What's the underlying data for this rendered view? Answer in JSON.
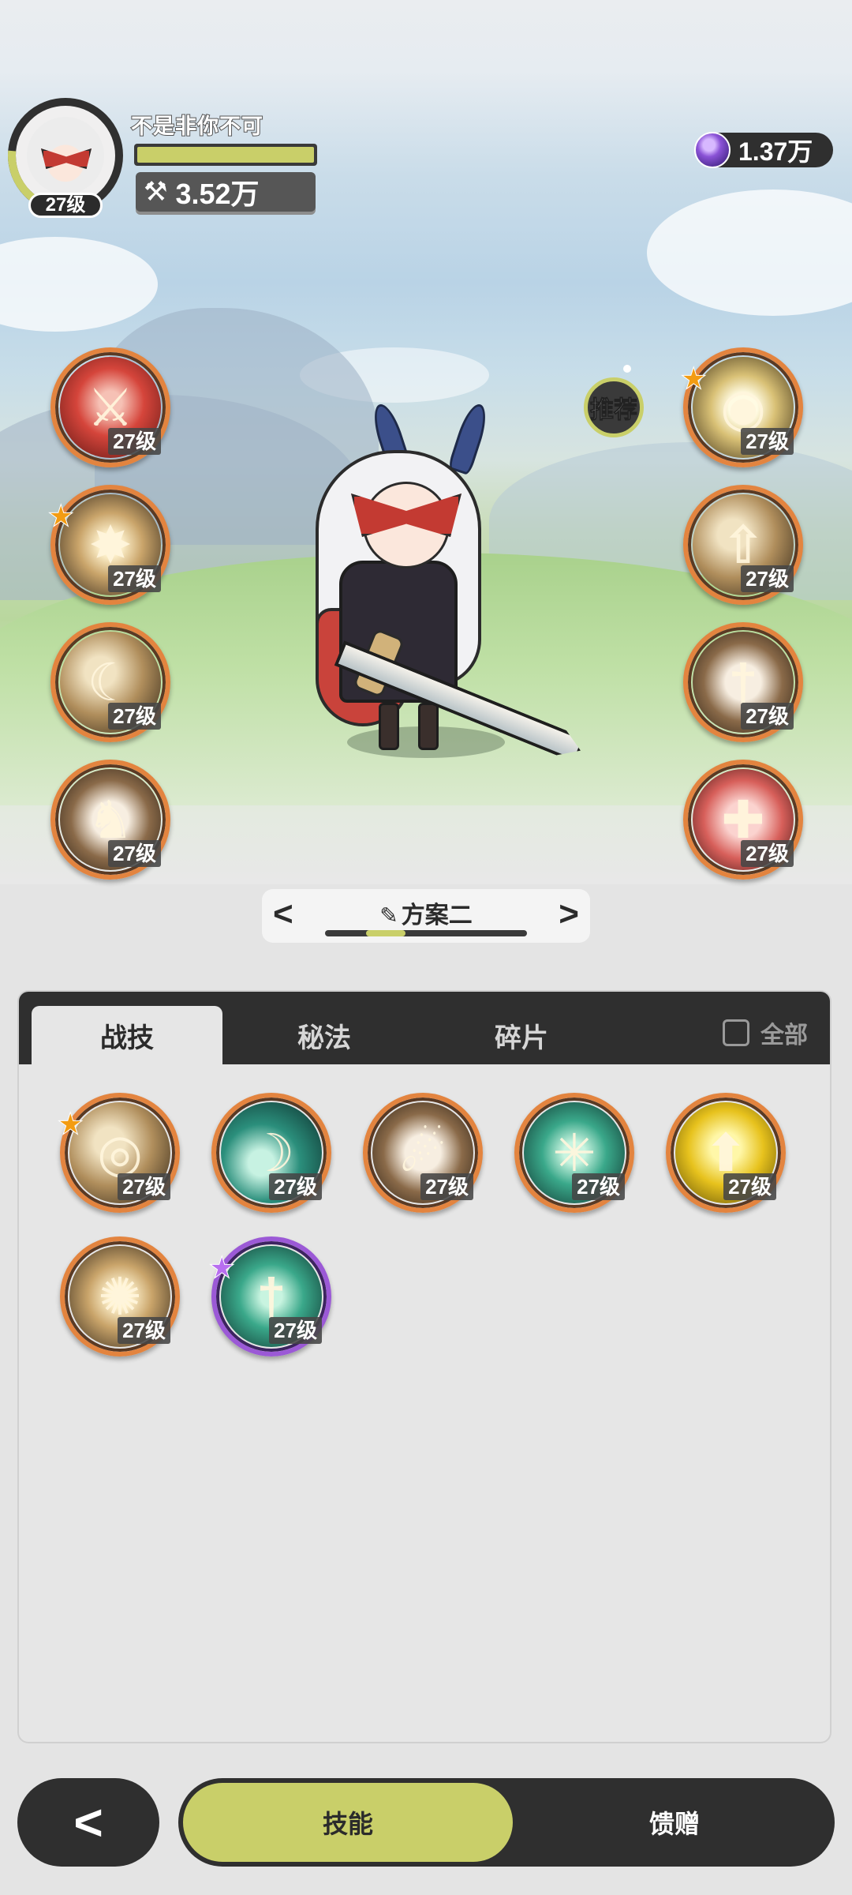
{
  "player": {
    "name": "不是非你不可",
    "level_label": "27级",
    "exp_fraction": 1.0,
    "power": "3.52万"
  },
  "currency": {
    "amount": "1.37万",
    "icon": "purple-gem-icon"
  },
  "recommend_label": "推荐",
  "left_skills": [
    {
      "name": "blood-slash",
      "level": "27级",
      "starred": false,
      "theme": "red",
      "glyph": "⚔"
    },
    {
      "name": "dark-burst",
      "level": "27级",
      "starred": true,
      "theme": "gold",
      "glyph": "✸"
    },
    {
      "name": "cleave",
      "level": "27级",
      "starred": false,
      "theme": "tan",
      "glyph": "☾"
    },
    {
      "name": "beast-charge",
      "level": "27级",
      "starred": false,
      "theme": "brown",
      "glyph": "♞"
    }
  ],
  "right_skills": [
    {
      "name": "insight-eye",
      "level": "27级",
      "starred": true,
      "theme": "eye",
      "glyph": "◉"
    },
    {
      "name": "attack-up",
      "level": "27级",
      "starred": false,
      "theme": "tan",
      "glyph": "⇧"
    },
    {
      "name": "sword-guard",
      "level": "27级",
      "starred": false,
      "theme": "brown",
      "glyph": "†"
    },
    {
      "name": "crit-heal",
      "level": "27级",
      "starred": false,
      "theme": "pink",
      "glyph": "✚"
    }
  ],
  "plan": {
    "title": "方案二",
    "prev": "<",
    "next": ">",
    "pen": "✎"
  },
  "tabs": [
    {
      "label": "战技",
      "active": true
    },
    {
      "label": "秘法",
      "active": false
    },
    {
      "label": "碎片",
      "active": false
    }
  ],
  "filter_all_label": "全部",
  "inventory": [
    {
      "name": "whirl-slash",
      "level": "27级",
      "starred": true,
      "star_color": "orange",
      "theme": "tan",
      "glyph": "◎"
    },
    {
      "name": "wind-blade",
      "level": "27级",
      "starred": false,
      "theme": "teal",
      "glyph": "☽"
    },
    {
      "name": "rising-strike",
      "level": "27级",
      "starred": false,
      "theme": "brown",
      "glyph": "☄"
    },
    {
      "name": "web-trap",
      "level": "27级",
      "starred": false,
      "theme": "jade",
      "glyph": "✳"
    },
    {
      "name": "golden-boost",
      "level": "27级",
      "starred": false,
      "theme": "yellow",
      "glyph": "⬆"
    },
    {
      "name": "shock-burst",
      "level": "27级",
      "starred": false,
      "theme": "gold",
      "glyph": "✺"
    },
    {
      "name": "spirit-sword",
      "level": "27级",
      "starred": true,
      "star_color": "purple",
      "theme": "jade",
      "glyph": "†",
      "rare": true
    }
  ],
  "bottom_nav": {
    "back": "<",
    "skills": "技能",
    "gift": "馈赠"
  }
}
